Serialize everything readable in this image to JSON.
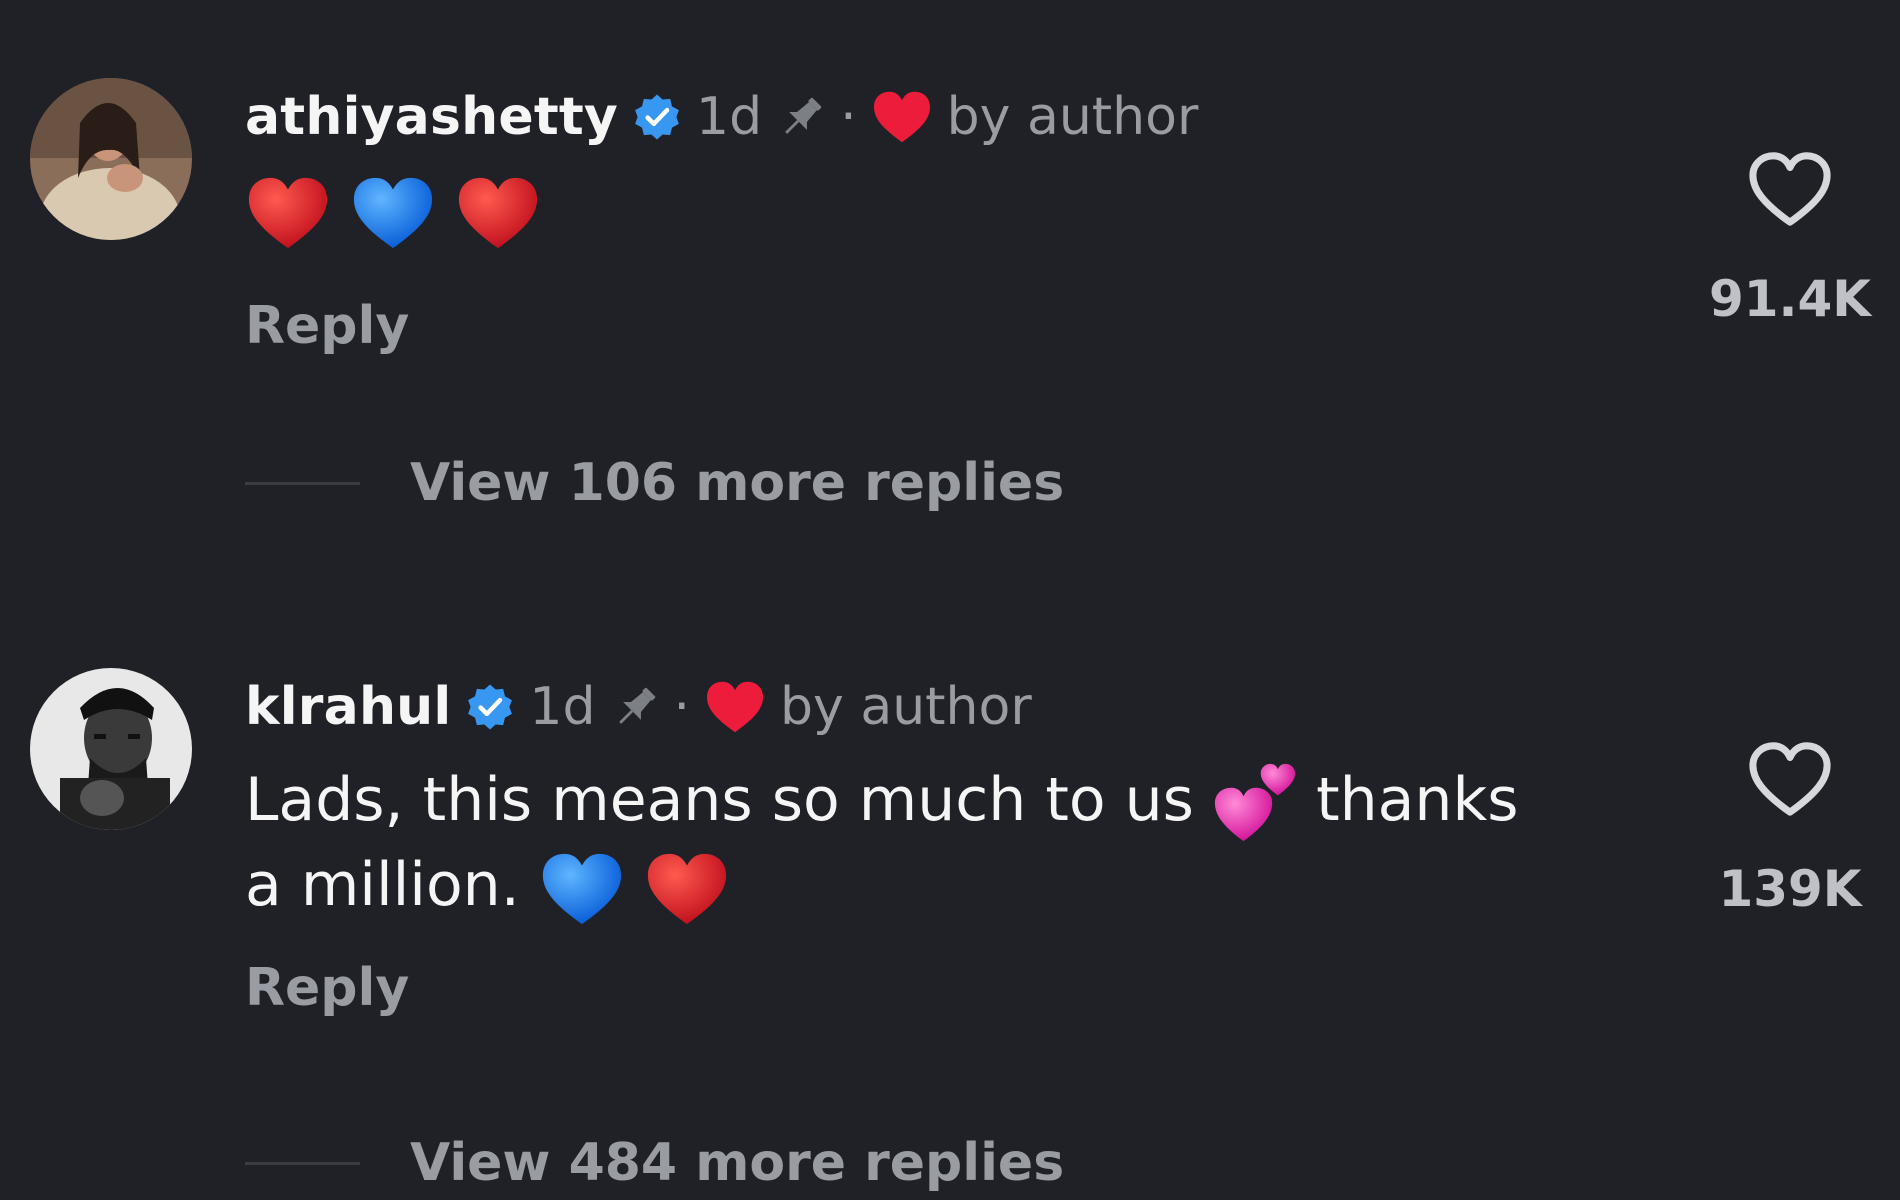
{
  "comments": [
    {
      "username": "athiyashetty",
      "verified": true,
      "time": "1d",
      "separator": "·",
      "liked_by_author_label": "by author",
      "body_emoji": [
        "red-heart",
        "blue-heart",
        "red-heart"
      ],
      "reply_label": "Reply",
      "like_count": "91.4K",
      "view_replies_label": "View 106 more replies"
    },
    {
      "username": "klrahul",
      "verified": true,
      "time": "1d",
      "separator": "·",
      "liked_by_author_label": "by author",
      "body_text_part1": "Lads, this means so much to us",
      "body_text_part2": "thanks",
      "body_text_part3": "a million.",
      "body_emoji": [
        "two-hearts",
        "blue-heart",
        "red-heart"
      ],
      "reply_label": "Reply",
      "like_count": "139K",
      "view_replies_label": "View 484 more replies"
    }
  ],
  "colors": {
    "background": "#1f2127",
    "verified_blue": "#3897f0",
    "author_heart_red": "#ed1c3a",
    "muted_text": "#9a9ca3"
  }
}
